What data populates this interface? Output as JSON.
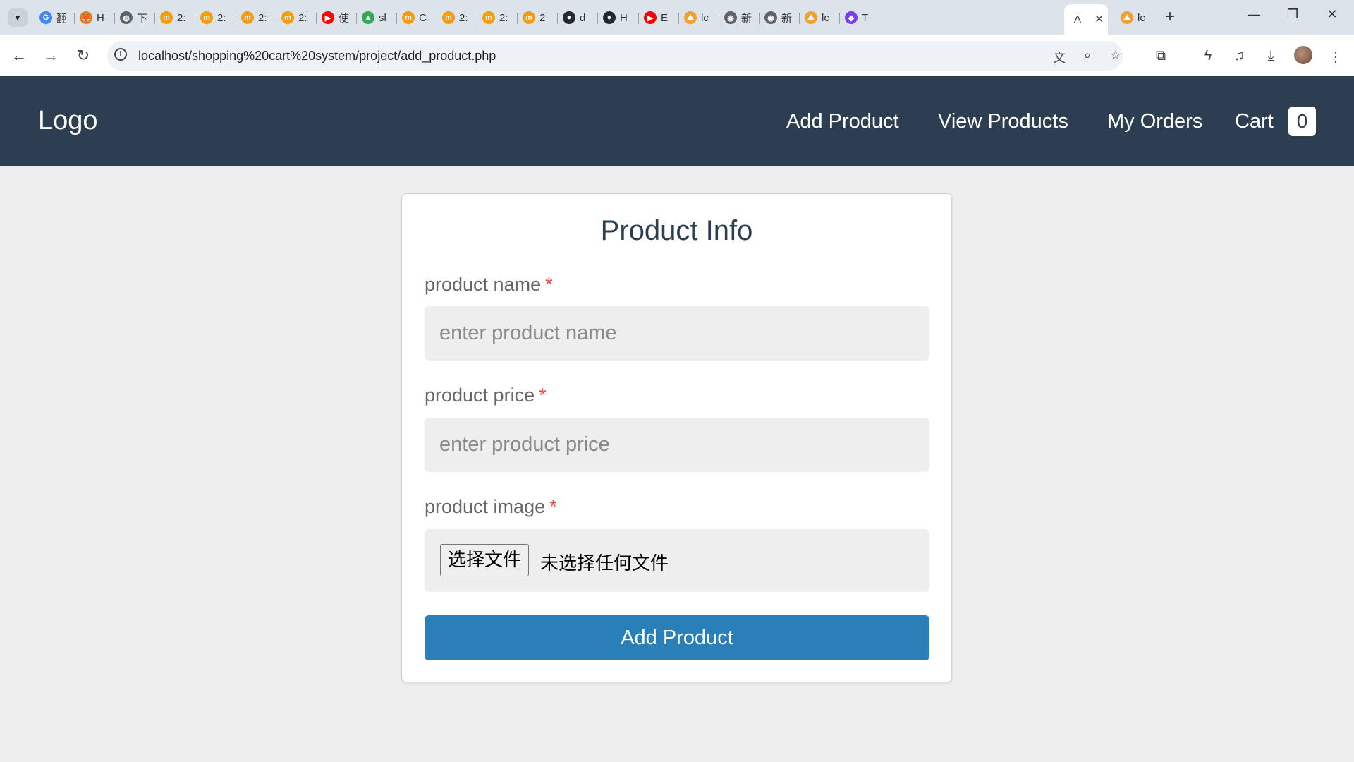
{
  "browser": {
    "tabs": [
      {
        "title": "翻",
        "icon": "google-icon",
        "color": "#4285f4",
        "glyph": "G"
      },
      {
        "title": "H",
        "icon": "fox-icon",
        "color": "#e67e22",
        "glyph": "🦊"
      },
      {
        "title": "下",
        "icon": "globe-icon",
        "color": "#5f6368",
        "glyph": "◍"
      },
      {
        "title": "2:",
        "icon": "m-logo-icon",
        "color": "#f39c12",
        "glyph": "m"
      },
      {
        "title": "2:",
        "icon": "m-logo-icon",
        "color": "#f39c12",
        "glyph": "m"
      },
      {
        "title": "2:",
        "icon": "m-logo-icon",
        "color": "#f39c12",
        "glyph": "m"
      },
      {
        "title": "2:",
        "icon": "m-logo-icon",
        "color": "#f39c12",
        "glyph": "m"
      },
      {
        "title": "使",
        "icon": "youtube-icon",
        "color": "#ff0000",
        "glyph": "▶"
      },
      {
        "title": "sl",
        "icon": "drive-icon",
        "color": "#34a853",
        "glyph": "▲"
      },
      {
        "title": "C",
        "icon": "m-logo-icon",
        "color": "#f39c12",
        "glyph": "m"
      },
      {
        "title": "2:",
        "icon": "m-logo-icon",
        "color": "#f39c12",
        "glyph": "m"
      },
      {
        "title": "2:",
        "icon": "m-logo-icon",
        "color": "#f39c12",
        "glyph": "m"
      },
      {
        "title": "2",
        "icon": "m-logo-icon",
        "color": "#f39c12",
        "glyph": "m"
      },
      {
        "title": "d",
        "icon": "github-icon",
        "color": "#24292e",
        "glyph": "●"
      },
      {
        "title": "H",
        "icon": "github-icon",
        "color": "#24292e",
        "glyph": "●"
      },
      {
        "title": "E",
        "icon": "youtube-icon",
        "color": "#ff0000",
        "glyph": "▶"
      },
      {
        "title": "lc",
        "icon": "pma-icon",
        "color": "#f0a030",
        "glyph": "⛰"
      },
      {
        "title": "新",
        "icon": "chrome-icon",
        "color": "#5f6368",
        "glyph": "◉"
      },
      {
        "title": "新",
        "icon": "chrome-icon",
        "color": "#5f6368",
        "glyph": "◉"
      },
      {
        "title": "lc",
        "icon": "pma-icon",
        "color": "#f0a030",
        "glyph": "⛰"
      },
      {
        "title": "T",
        "icon": "t-logo-icon",
        "color": "#7b3fe4",
        "glyph": "◆"
      }
    ],
    "active_tab": {
      "title": "A"
    },
    "last_tab": {
      "title": "lc",
      "icon": "pma-icon",
      "color": "#f0a030",
      "glyph": "⛰"
    },
    "url": "localhost/shopping%20cart%20system/project/add_product.php"
  },
  "header": {
    "logo": "Logo",
    "nav": [
      {
        "label": "Add Product"
      },
      {
        "label": "View Products"
      },
      {
        "label": "My Orders"
      },
      {
        "label": "Cart"
      }
    ],
    "cart_count": "0"
  },
  "form": {
    "title": "Product Info",
    "name": {
      "label": "product name",
      "required_mark": "*",
      "placeholder": "enter product name"
    },
    "price": {
      "label": "product price",
      "required_mark": "*",
      "placeholder": "enter product price"
    },
    "image": {
      "label": "product image",
      "required_mark": "*",
      "button_label": "选择文件",
      "status": "未选择任何文件"
    },
    "submit_label": "Add Product"
  },
  "colors": {
    "header_bg": "#2c3e50",
    "accent": "#2980b9",
    "required": "#e74c3c"
  }
}
